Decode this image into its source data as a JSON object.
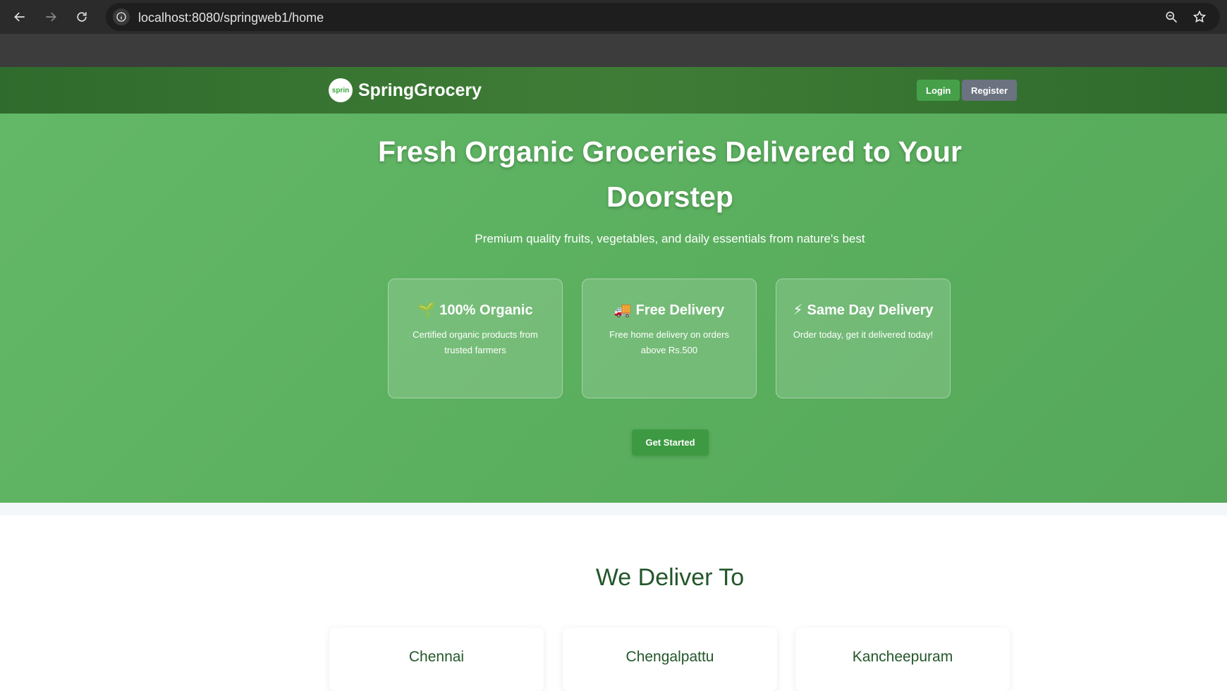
{
  "browser": {
    "url": "localhost:8080/springweb1/home",
    "back_icon": "arrow-left-icon",
    "forward_icon": "arrow-right-icon",
    "reload_icon": "reload-icon",
    "site_info_icon": "info-icon",
    "zoom_icon": "zoom-icon",
    "bookmark_icon": "star-icon"
  },
  "header": {
    "logo_text": "sprin",
    "brand": "SpringGrocery",
    "login_label": "Login",
    "register_label": "Register"
  },
  "hero": {
    "title": "Fresh Organic Groceries Delivered to Your Doorstep",
    "subtitle": "Premium quality fruits, vegetables, and daily essentials from nature's best",
    "features": [
      {
        "icon": "🌱",
        "title": "100% Organic",
        "desc": "Certified organic products from trusted farmers"
      },
      {
        "icon": "🚚",
        "title": "Free Delivery",
        "desc": "Free home delivery on orders above Rs.500"
      },
      {
        "icon": "⚡",
        "title": "Same Day Delivery",
        "desc": "Order today, get it delivered today!"
      }
    ],
    "cta_label": "Get Started"
  },
  "deliver": {
    "title": "We Deliver To",
    "cities": [
      "Chennai",
      "Chengalpattu",
      "Kancheepuram"
    ]
  },
  "colors": {
    "header_bg": "#3a7734",
    "hero_bg": "#5aaf5e",
    "login_btn": "#46a04a",
    "register_btn": "#6b7280",
    "accent_text": "#23562a"
  }
}
